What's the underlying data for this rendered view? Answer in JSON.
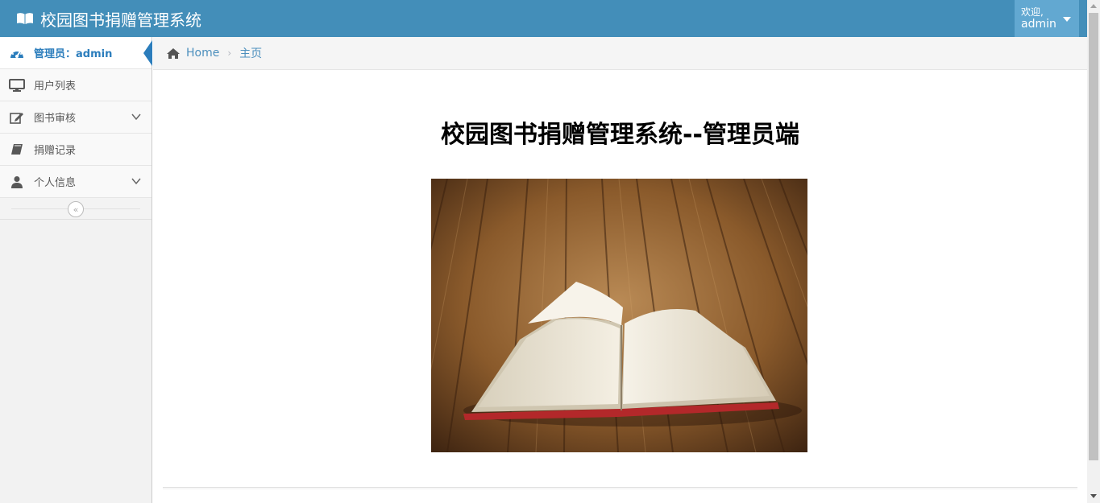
{
  "header": {
    "app_title": "校园图书捐赠管理系统",
    "welcome": "欢迎,",
    "username": "admin"
  },
  "sidebar": {
    "items": [
      {
        "label": "管理员：admin",
        "icon": "dashboard-icon"
      },
      {
        "label": "用户列表",
        "icon": "desktop-icon"
      },
      {
        "label": "图书审核",
        "icon": "edit-icon"
      },
      {
        "label": "捐赠记录",
        "icon": "book-icon"
      },
      {
        "label": "个人信息",
        "icon": "user-icon"
      }
    ]
  },
  "breadcrumb": {
    "home": "Home",
    "current": "主页"
  },
  "main": {
    "title": "校园图书捐赠管理系统--管理员端"
  },
  "colors": {
    "navbar": "#438eb9",
    "accent": "#2b7dbc"
  }
}
